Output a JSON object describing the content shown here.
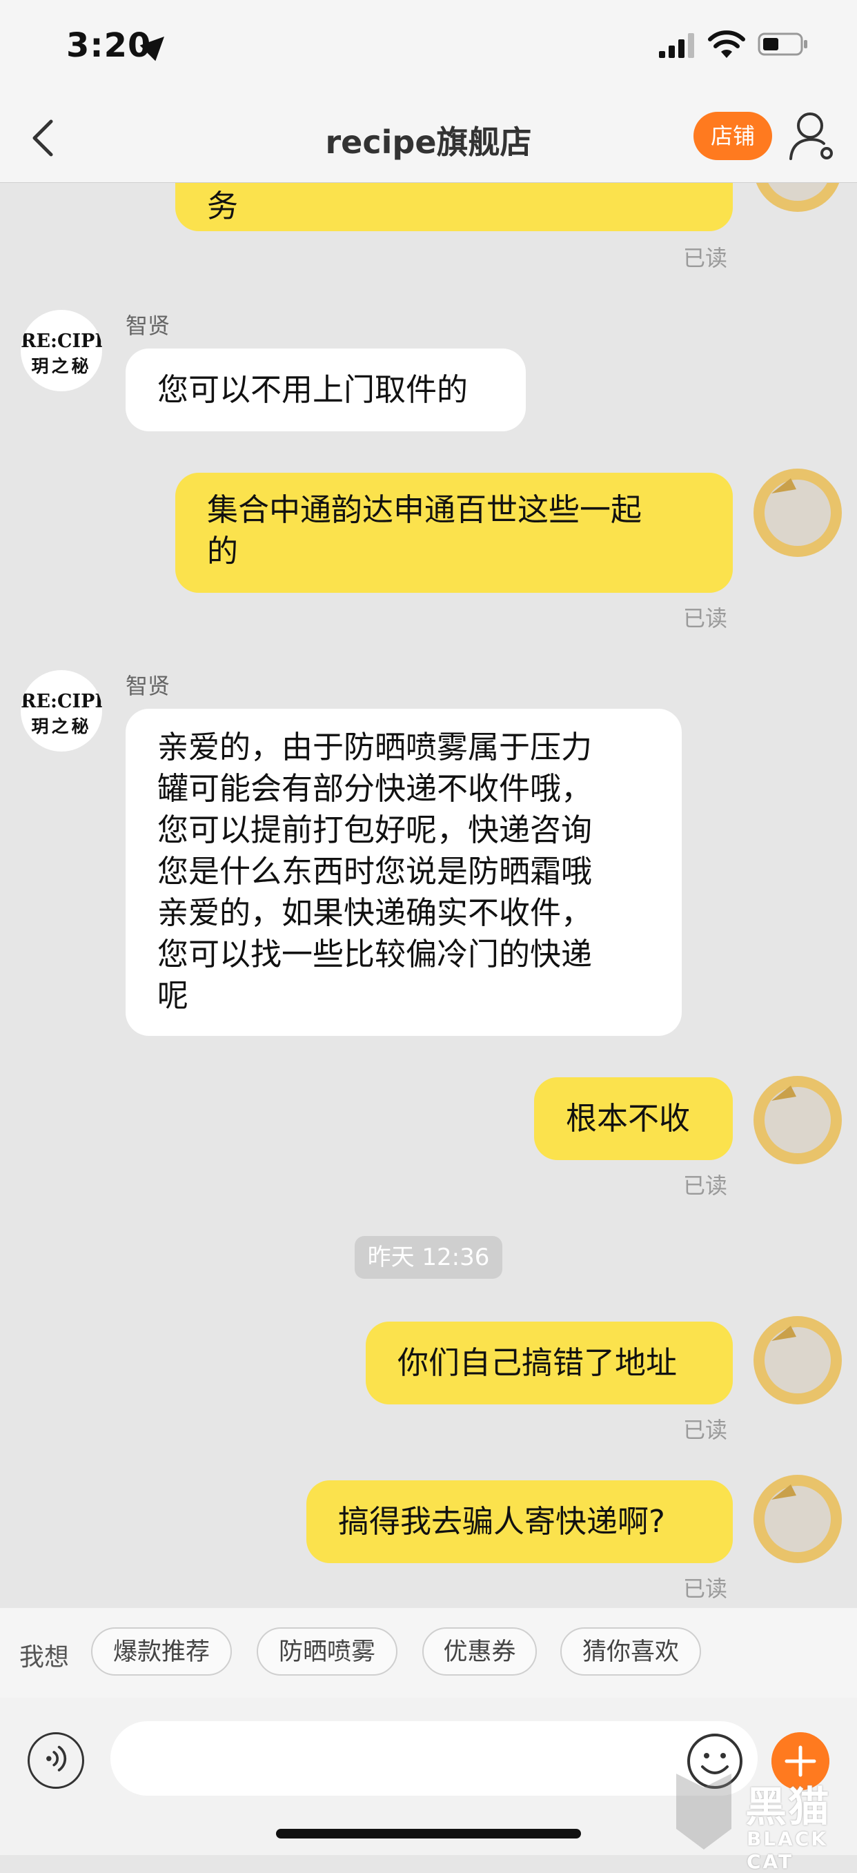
{
  "status_bar": {
    "time": "3:20",
    "icons": [
      "location-arrow-icon",
      "signal-icon",
      "wifi-icon",
      "battery-icon"
    ]
  },
  "nav": {
    "title": "recipe旗舰店",
    "shop_button": "店铺",
    "back_icon": "chevron-left-icon",
    "profile_icon": "user-settings-icon"
  },
  "colors": {
    "accent": "#ff7a1f",
    "outgoing_bubble": "#fbe24d",
    "incoming_bubble": "#ffffff",
    "background": "#e6e6e6"
  },
  "shop_avatar": {
    "line1": "RE:CIPE",
    "line2": "玥之秘"
  },
  "messages": [
    {
      "dir": "out",
      "lines": [
        "务"
      ],
      "status": "已读"
    },
    {
      "dir": "in",
      "sender": "智贤",
      "lines": [
        "您可以不用上门取件的"
      ]
    },
    {
      "dir": "out",
      "lines": [
        "集合中通韵达申通百世这些一起",
        "的"
      ],
      "status": "已读"
    },
    {
      "dir": "in",
      "sender": "智贤",
      "lines": [
        "亲爱的，由于防晒喷雾属于压力",
        "罐可能会有部分快递不收件哦，",
        "您可以提前打包好呢，快递咨询",
        "您是什么东西时您说是防晒霜哦",
        "亲爱的，如果快递确实不收件，",
        "您可以找一些比较偏冷门的快递",
        "呢"
      ]
    },
    {
      "dir": "out",
      "lines": [
        "根本不收"
      ],
      "status": "已读"
    },
    {
      "dir": "time",
      "text": "昨天 12:36"
    },
    {
      "dir": "out",
      "lines": [
        "你们自己搞错了地址"
      ],
      "status": "已读"
    },
    {
      "dir": "out",
      "lines": [
        "搞得我去骗人寄快递啊?"
      ],
      "status": "已读"
    }
  ],
  "quick_bar": {
    "label": "我想",
    "chips": [
      "爆款推荐",
      "防晒喷雾",
      "优惠券",
      "猜你喜欢"
    ]
  },
  "input_bar": {
    "placeholder": "",
    "voice_icon": "voice-icon",
    "emoji_icon": "emoji-icon",
    "plus_icon": "plus-icon"
  },
  "watermark": {
    "text": "黑猫",
    "sub": "BLACK CAT"
  }
}
